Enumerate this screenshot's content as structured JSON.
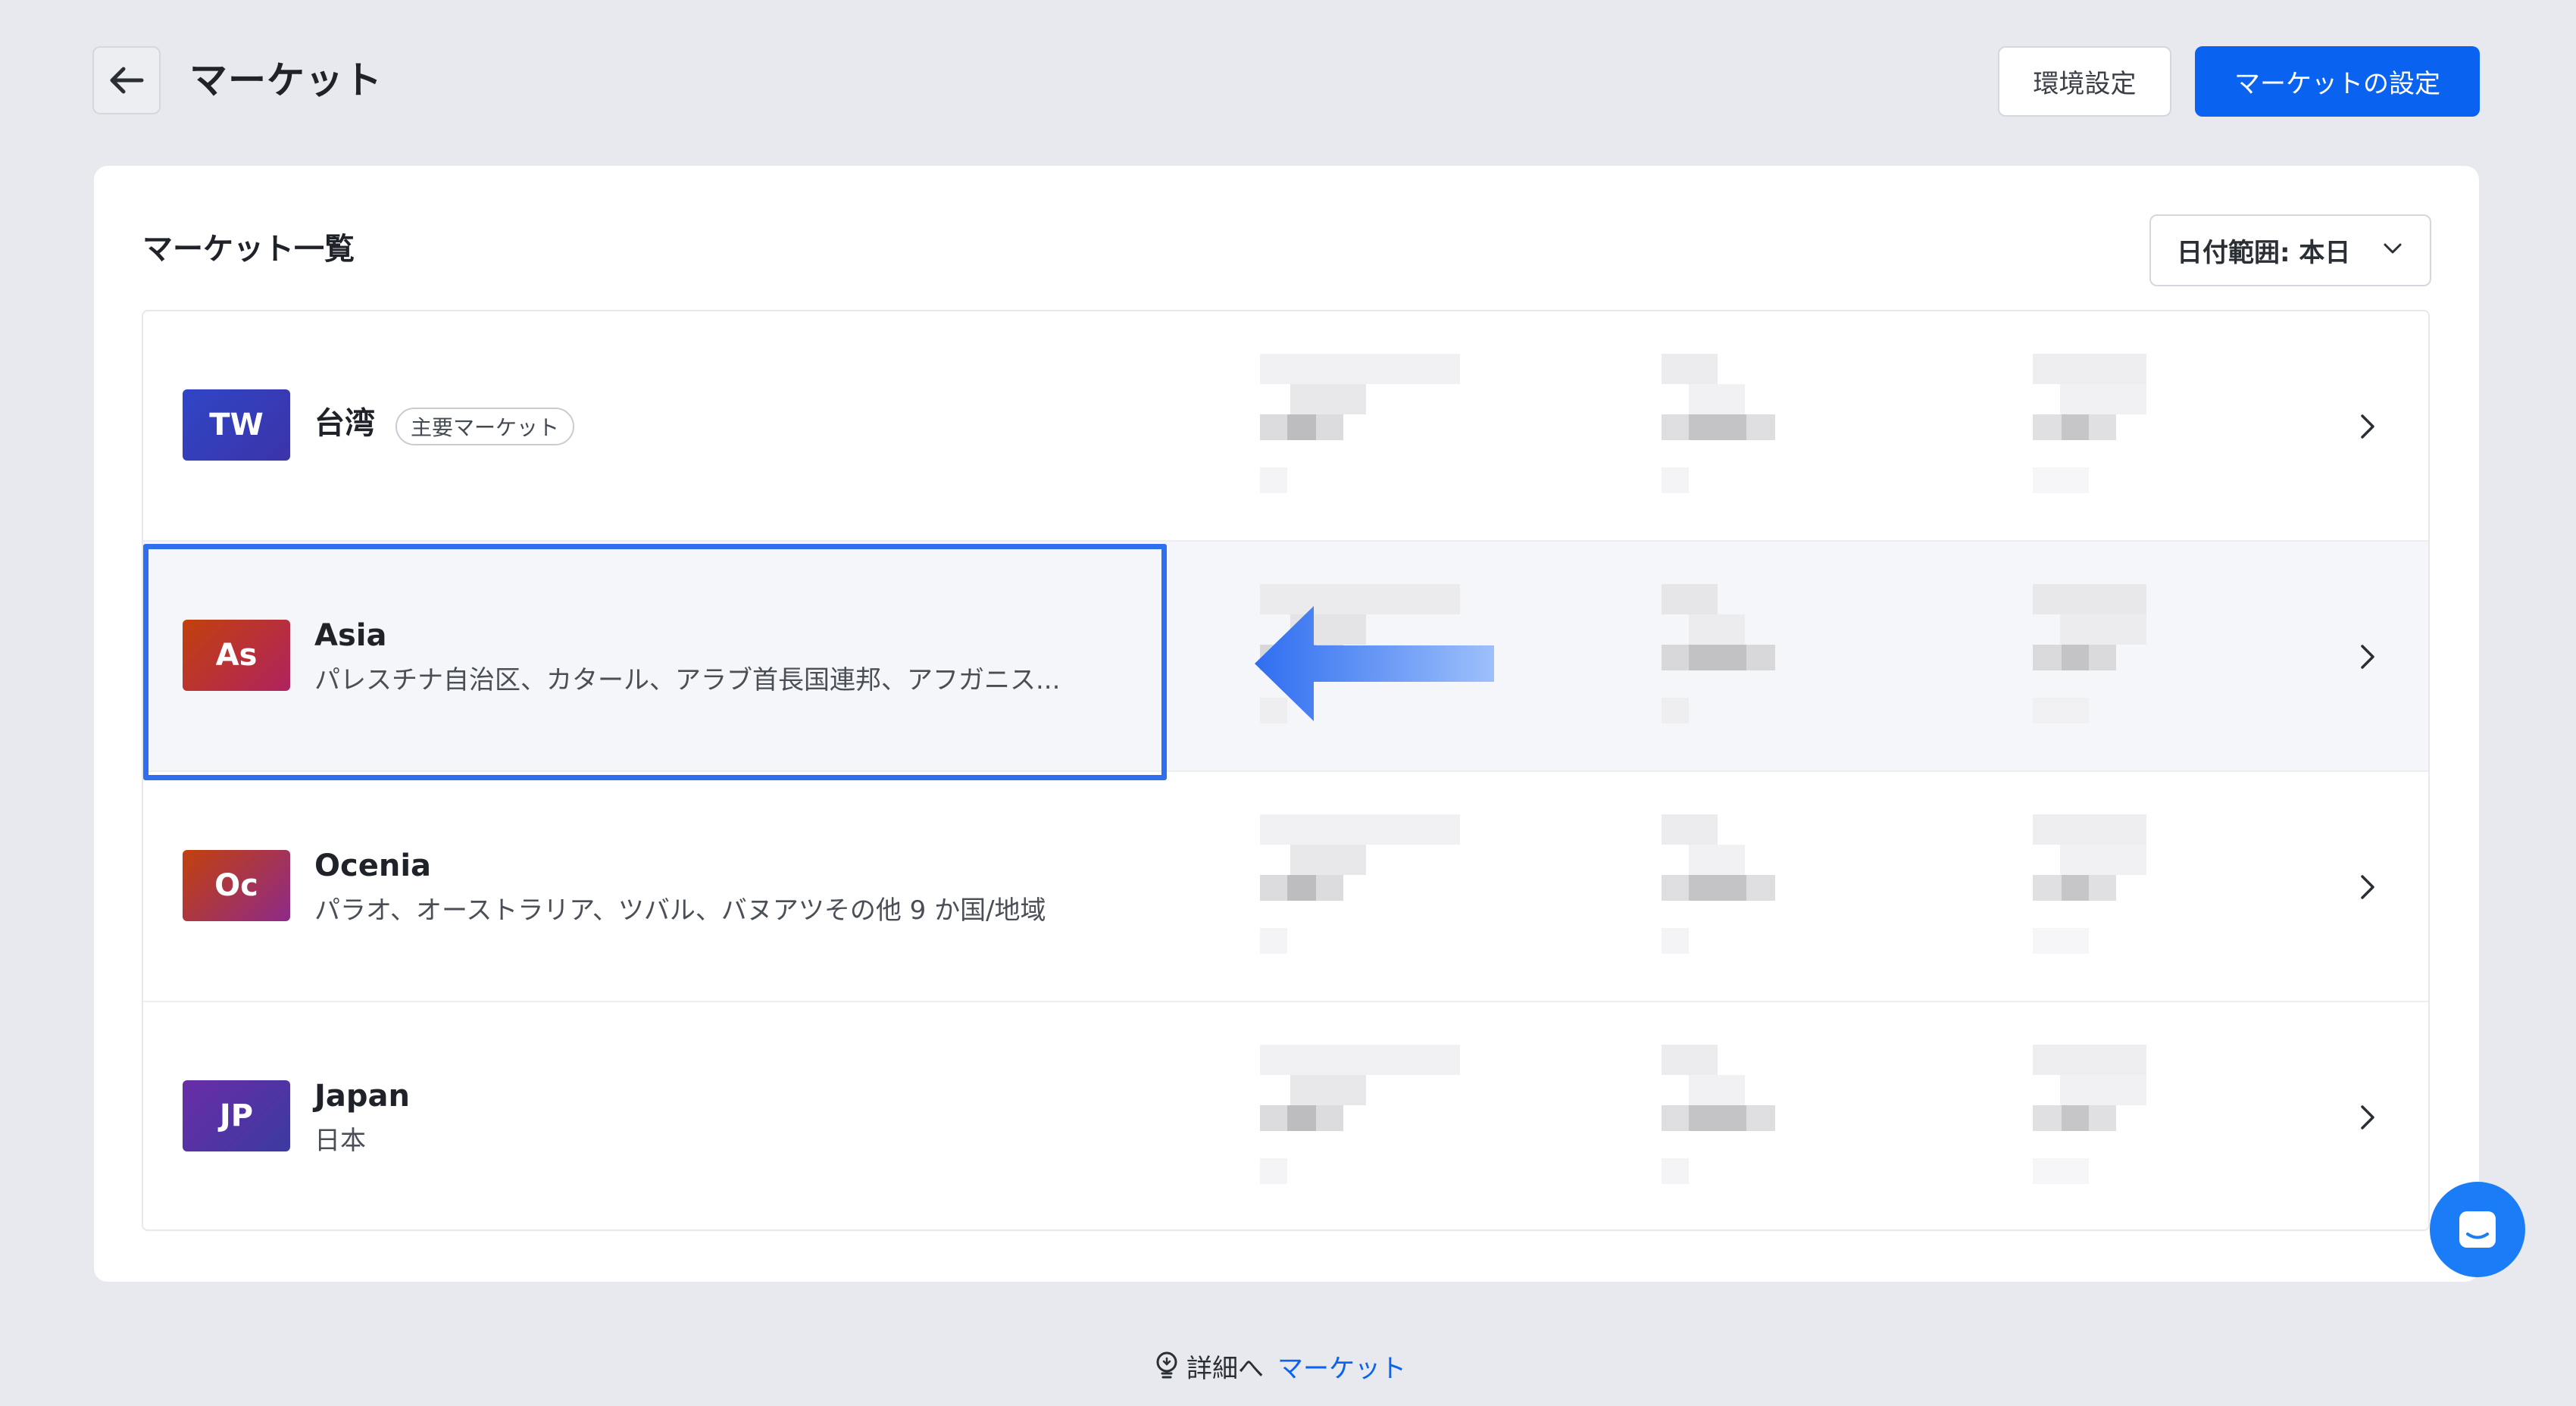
{
  "header": {
    "title": "マーケット",
    "env_settings_label": "環境設定",
    "market_settings_label": "マーケットの設定"
  },
  "card": {
    "title": "マーケット一覧",
    "date_filter_label": "日付範囲: 本日"
  },
  "markets": [
    {
      "code": "TW",
      "name": "台湾",
      "tag": "主要マーケット",
      "description": "",
      "badge_color": "#2f46c7"
    },
    {
      "code": "As",
      "name": "Asia",
      "tag": "",
      "description": "パレスチナ自治区、カタール、アラブ首長国連邦、アフガニス...",
      "badge_color": "#c42a5f"
    },
    {
      "code": "Oc",
      "name": "Ocenia",
      "tag": "",
      "description": "パラオ、オーストラリア、ツバル、バヌアツその他 9 か国/地域",
      "badge_color": "#c0345a"
    },
    {
      "code": "JP",
      "name": "Japan",
      "tag": "",
      "description": "日本",
      "badge_color": "#5a2fa6"
    }
  ],
  "footer": {
    "help_text": "詳細へ",
    "help_link": "マーケット"
  },
  "colors": {
    "primary": "#0a63f0",
    "highlight_border": "#2f6ef0",
    "page_background": "#e7e9ee"
  }
}
